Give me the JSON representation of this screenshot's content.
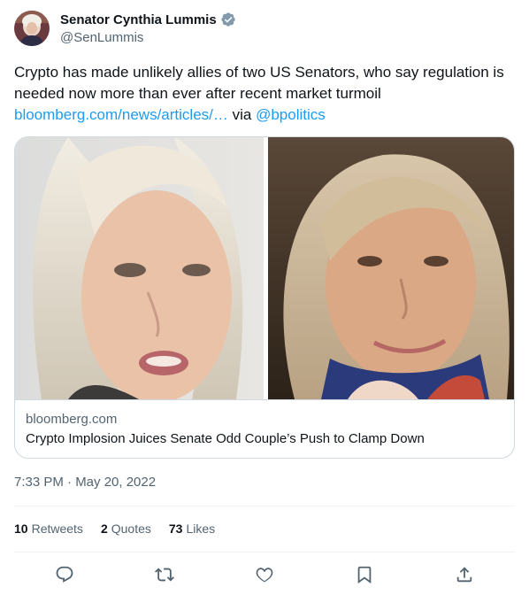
{
  "author": {
    "name": "Senator Cynthia Lummis",
    "handle": "@SenLummis"
  },
  "tweet": {
    "text": "Crypto has made unlikely allies of two US Senators, who say regulation is needed now more than ever after recent market turmoil",
    "link": "bloomberg.com/news/articles/…",
    "via": "via",
    "mention": "@bpolitics"
  },
  "card": {
    "domain": "bloomberg.com",
    "title": "Crypto Implosion Juices Senate Odd Couple’s Push to Clamp Down"
  },
  "timestamp": "7:33 PM · May 20, 2022",
  "stats": {
    "retweets": {
      "count": "10",
      "label": "Retweets"
    },
    "quotes": {
      "count": "2",
      "label": "Quotes"
    },
    "likes": {
      "count": "73",
      "label": "Likes"
    }
  },
  "colors": {
    "link": "#1d9bf0",
    "verified": "#829aab",
    "secondary_text": "#536471"
  },
  "icons": [
    "verified-badge-icon",
    "reply-icon",
    "retweet-icon",
    "like-icon",
    "bookmark-icon",
    "share-icon"
  ]
}
